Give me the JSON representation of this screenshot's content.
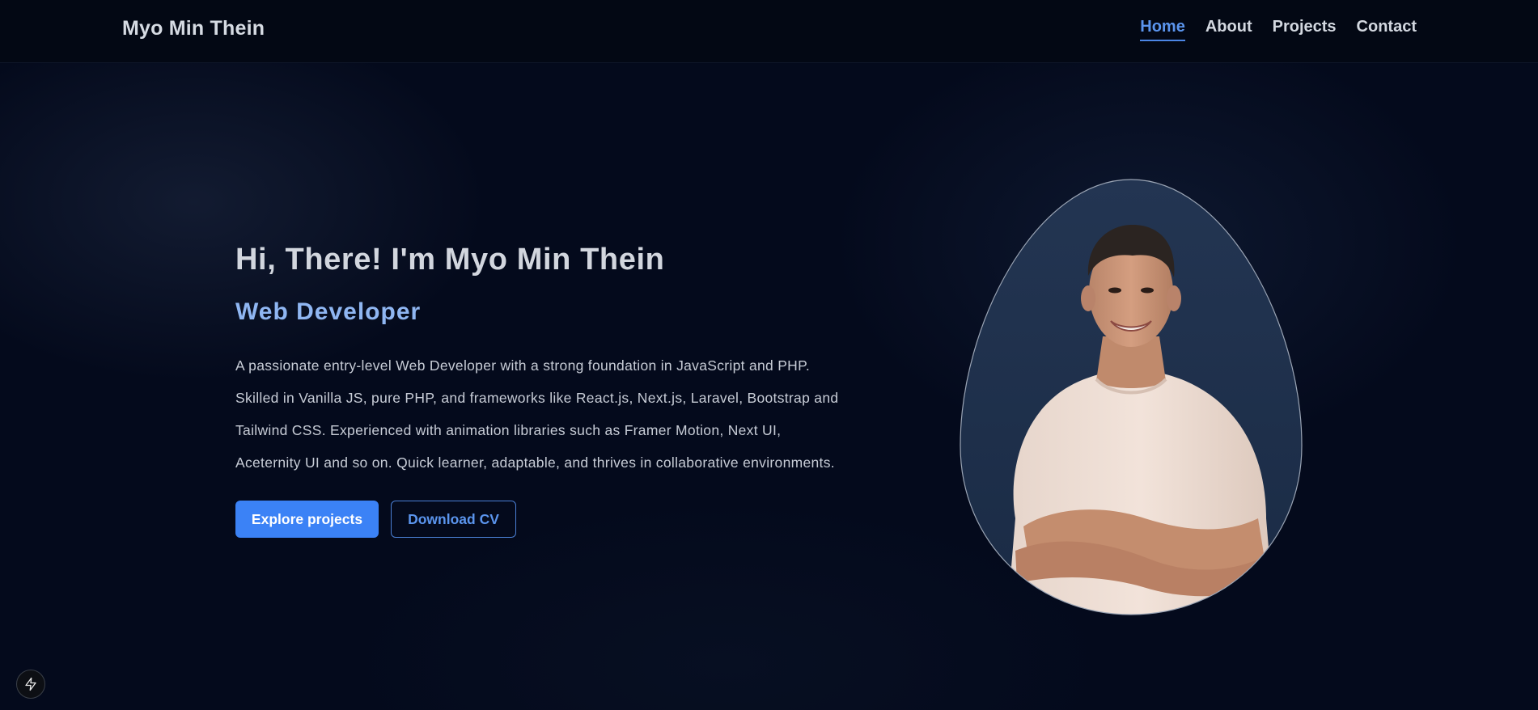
{
  "header": {
    "brand": "Myo Min Thein",
    "nav": [
      {
        "label": "Home",
        "active": true
      },
      {
        "label": "About",
        "active": false
      },
      {
        "label": "Projects",
        "active": false
      },
      {
        "label": "Contact",
        "active": false
      }
    ]
  },
  "hero": {
    "title": "Hi, There! I'm Myo Min Thein",
    "role": "Web Developer",
    "description": [
      "A passionate entry-level Web Developer with a strong foundation in JavaScript and PHP.",
      "Skilled in Vanilla JS, pure PHP, and frameworks like React.js, Next.js, Laravel, Bootstrap and",
      "Tailwind CSS. Experienced with animation libraries such as Framer Motion, Next UI,",
      "Aceternity UI and so on. Quick learner, adaptable, and thrives in collaborative environments."
    ],
    "primary_button": "Explore projects",
    "secondary_button": "Download CV"
  },
  "portrait": {
    "icon": "profile-photo"
  },
  "dev_indicator": {
    "icon": "bolt-icon"
  },
  "colors": {
    "accent": "#3b82f6",
    "accent_text": "#5b95ee",
    "role_text": "#8fb6f2",
    "background": "#040a1c"
  }
}
